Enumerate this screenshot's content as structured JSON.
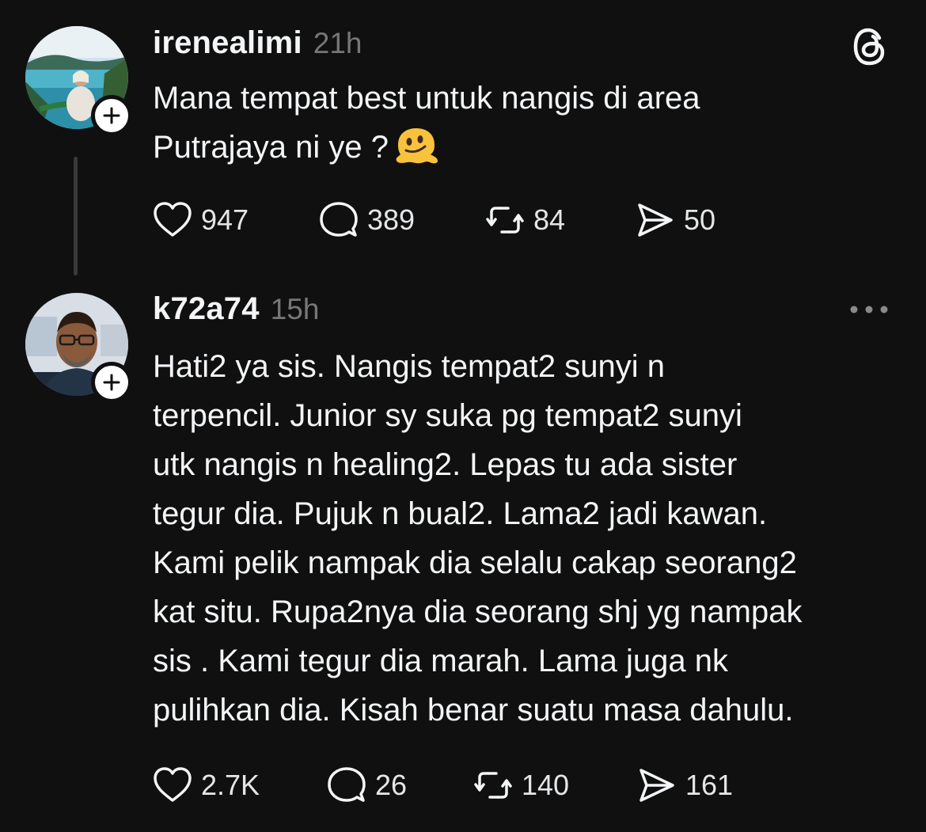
{
  "posts": [
    {
      "username": "irenealimi",
      "time": "21h",
      "lines": [
        "Mana tempat best untuk nangis di area",
        "Putrajaya ni ye ?"
      ],
      "emoji": "melting-face-emoji",
      "stats": {
        "likes": "947",
        "replies": "389",
        "reposts": "84",
        "shares": "50"
      },
      "corner_icon": "threads-logo-icon"
    },
    {
      "username": "k72a74",
      "time": "15h",
      "lines": [
        "Hati2 ya sis. Nangis tempat2 sunyi n",
        "terpencil. Junior sy suka pg tempat2 sunyi",
        "utk nangis n healing2.  Lepas tu ada sister",
        "tegur dia. Pujuk n bual2. Lama2 jadi kawan.",
        "Kami pelik nampak dia selalu cakap seorang2",
        "kat situ. Rupa2nya dia seorang shj yg nampak",
        "sis . Kami tegur dia marah. Lama juga nk",
        "pulihkan dia. Kisah benar suatu masa dahulu."
      ],
      "stats": {
        "likes": "2.7K",
        "replies": "26",
        "reposts": "140",
        "shares": "161"
      },
      "corner_icon": "more-options-icon"
    }
  ],
  "colors": {
    "background": "#101010",
    "text": "#f3f5f7",
    "muted": "#777777",
    "thread_line": "#3a3a3a"
  }
}
